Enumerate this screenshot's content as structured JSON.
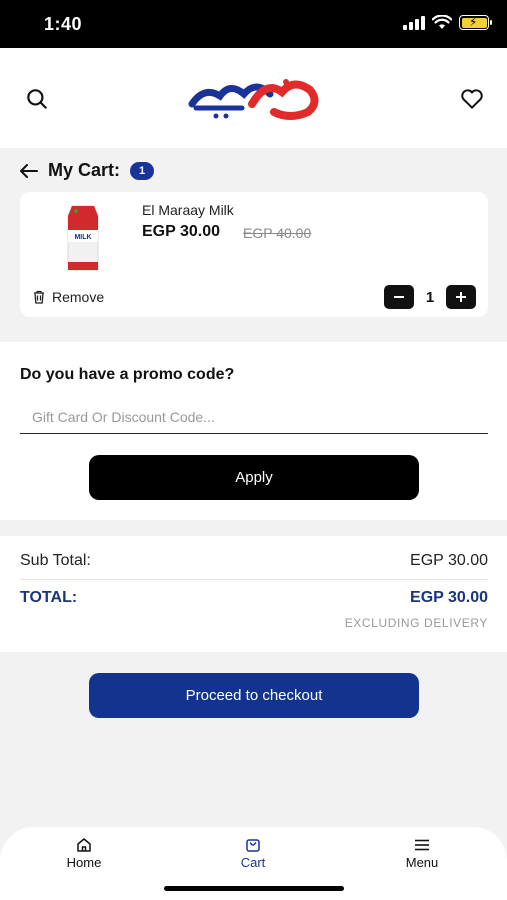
{
  "status_bar": {
    "time": "1:40"
  },
  "header": {
    "brand_color": "#1a3399",
    "logo_accent": "#e22a2a"
  },
  "cart": {
    "title": "My Cart:",
    "count": "1"
  },
  "item": {
    "name": "El Maraay Milk",
    "price": "EGP 30.00",
    "old_price": "EGP 40.00",
    "remove_label": "Remove",
    "quantity": "1",
    "image_label": "MILK"
  },
  "promo": {
    "label": "Do you have a promo code?",
    "placeholder": "Gift Card Or Discount Code...",
    "apply_label": "Apply"
  },
  "totals": {
    "subtotal_label": "Sub Total:",
    "subtotal_value": "EGP 30.00",
    "total_label": "TOTAL:",
    "total_value": "EGP 30.00",
    "note": "EXCLUDING DELIVERY"
  },
  "checkout_label": "Proceed to checkout",
  "nav": {
    "home": "Home",
    "cart": "Cart",
    "menu": "Menu"
  },
  "colors": {
    "primary": "#12348f",
    "dark_button": "#000000"
  }
}
